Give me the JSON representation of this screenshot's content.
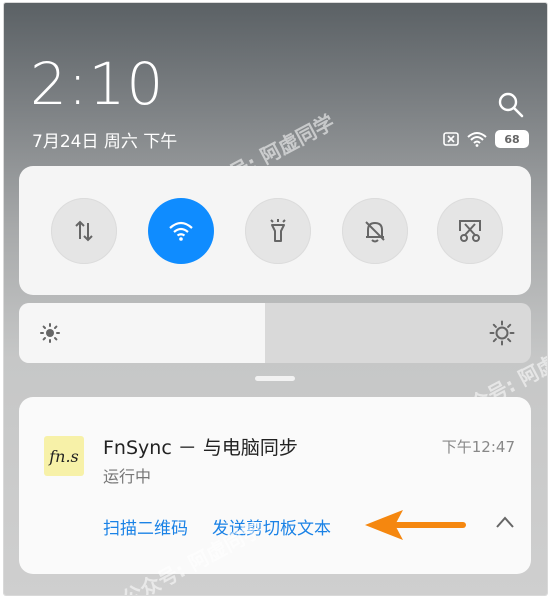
{
  "status": {
    "time": "2:10",
    "date": "7月24日 周六 下午",
    "battery": "68",
    "icons": [
      "sim-off-icon",
      "wifi-icon",
      "battery-icon"
    ]
  },
  "quick_toggles": [
    {
      "name": "mobile-data",
      "icon": "data-arrows-icon",
      "active": false
    },
    {
      "name": "wifi",
      "icon": "wifi-icon",
      "active": true
    },
    {
      "name": "flashlight",
      "icon": "flashlight-icon",
      "active": false
    },
    {
      "name": "silent",
      "icon": "bell-off-icon",
      "active": false
    },
    {
      "name": "screenshot",
      "icon": "scissors-screenshot-icon",
      "active": false
    }
  ],
  "brightness": {
    "level_percent": 48
  },
  "notification": {
    "app_icon_text": "fn.s",
    "title": "FnSync － 与电脑同步",
    "subtitle": "运行中",
    "time": "下午12:47",
    "actions": [
      "扫描二维码",
      "发送剪切板文本"
    ]
  },
  "watermark": "公众号: 阿虚同学",
  "colors": {
    "accent": "#0f8cff",
    "action_text": "#1a82e6",
    "arrow": "#f5870f",
    "app_icon_bg": "#f7f1a8"
  }
}
